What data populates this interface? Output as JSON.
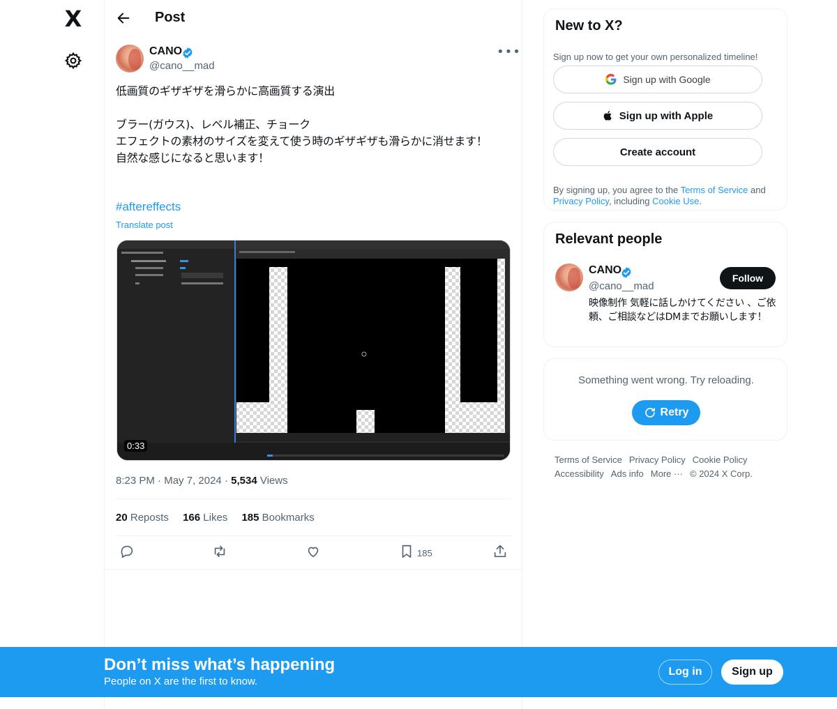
{
  "nav": {
    "logo": "X"
  },
  "header": {
    "title": "Post"
  },
  "post": {
    "author_name": "CANO",
    "author_handle": "@cano__mad",
    "text": "低画質のギザギザを滑らかに高画質する演出\n\nブラー(ガウス)、レベル補正、チョーク\nエフェクトの素材のサイズを変えて使う時のギザギザも滑らかに消せます！\n自然な感じになると思います！",
    "hashtag": "#aftereffects",
    "translate": "Translate post",
    "video_duration": "0:33",
    "time": "8:23 PM",
    "date": "May 7, 2024",
    "views_count": "5,534",
    "views_label": "Views",
    "reposts_count": "20",
    "reposts_label": "Reposts",
    "likes_count": "166",
    "likes_label": "Likes",
    "bookmarks_count": "185",
    "bookmarks_label": "Bookmarks",
    "bookmark_action_count": "185"
  },
  "signup_card": {
    "title": "New to X?",
    "subtitle": "Sign up now to get your own personalized timeline!",
    "google_label": "Sign up with Google",
    "apple_label": "Sign up with Apple",
    "create_label": "Create account",
    "terms_prefix": "By signing up, you agree to the ",
    "terms_link": "Terms of Service",
    "terms_and": " and ",
    "privacy_link": "Privacy Policy",
    "terms_including": ", including ",
    "cookie_link": "Cookie Use",
    "terms_end": "."
  },
  "relevant": {
    "title": "Relevant people",
    "name": "CANO",
    "handle": "@cano__mad",
    "follow_label": "Follow",
    "bio": "映像制作 気軽に話しかけてください 、ご依頼、ご相談などはDMまでお願いします！"
  },
  "error_card": {
    "message": "Something went wrong. Try reloading.",
    "retry_label": "Retry"
  },
  "footer": {
    "links": [
      "Terms of Service",
      "Privacy Policy",
      "Cookie Policy",
      "Accessibility",
      "Ads info",
      "More ···",
      "© 2024 X Corp."
    ]
  },
  "banner": {
    "title": "Don’t miss what’s happening",
    "subtitle": "People on X are the first to know.",
    "login_label": "Log in",
    "signup_label": "Sign up"
  },
  "colors": {
    "accent": "#1d9bf0",
    "text": "#0f1419",
    "muted": "#536471"
  }
}
